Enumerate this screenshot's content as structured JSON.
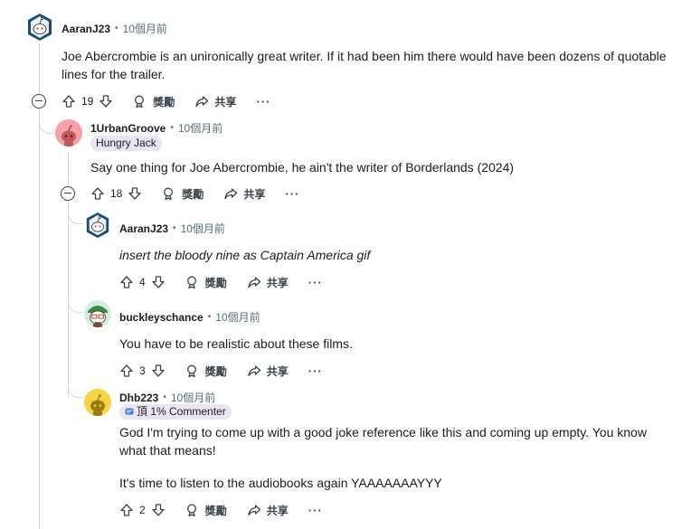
{
  "comments": [
    {
      "user": "AaranJ23",
      "time": "10個月前",
      "body": "Joe Abercrombie is an unironically great writer. If it had been him there would have been dozens of quotable lines for the trailer.",
      "votes": "19",
      "award": "獎勵",
      "share": "共享",
      "more": "···"
    },
    {
      "user": "1UrbanGroove",
      "time": "10個月前",
      "flair": "Hungry Jack",
      "body": "Say one thing for Joe Abercrombie, he ain't the writer of Borderlands (2024)",
      "votes": "18",
      "award": "獎勵",
      "share": "共享",
      "more": "···"
    },
    {
      "user": "AaranJ23",
      "time": "10個月前",
      "body": "insert the bloody nine as Captain America gif",
      "votes": "4",
      "award": "獎勵",
      "share": "共享",
      "more": "···"
    },
    {
      "user": "buckleyschance",
      "time": "10個月前",
      "body": "You have to be realistic about these films.",
      "votes": "3",
      "award": "獎勵",
      "share": "共享",
      "more": "···"
    },
    {
      "user": "Dhb223",
      "time": "10個月前",
      "flair": "頂 1% Commenter",
      "body_p1": "God I'm trying to come up with a good joke reference like this and coming up empty. You know what that means!",
      "body_p2": "It's time to listen to the audiobooks again YAAAAAAAYYY",
      "votes": "2",
      "award": "獎勵",
      "share": "共享",
      "more": "···"
    }
  ],
  "colors": {
    "thread_line": "#d5d8db",
    "meta_gray": "#576f76",
    "flair_bg": "#eae6f1"
  }
}
